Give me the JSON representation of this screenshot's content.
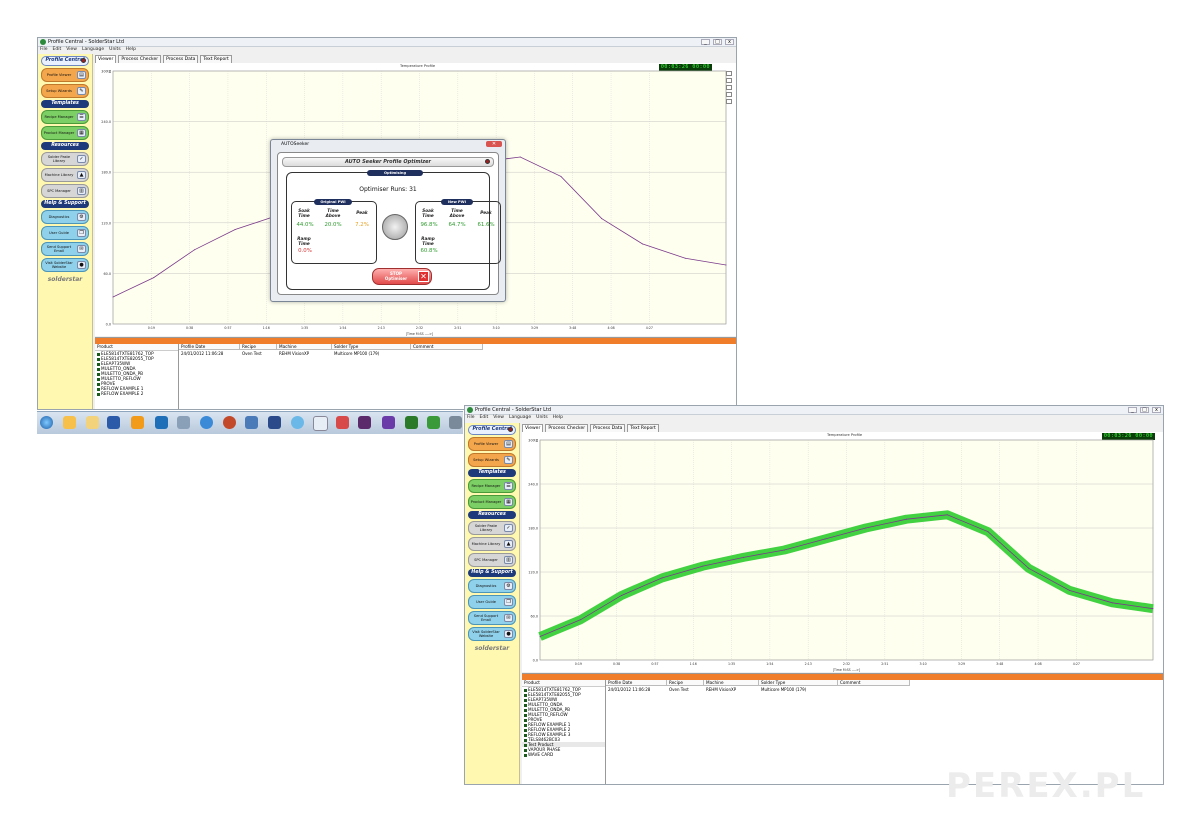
{
  "app": {
    "title": "Profile Central - SolderStar Ltd",
    "menu": [
      "File",
      "Edit",
      "View",
      "Language",
      "Units",
      "Help"
    ],
    "window_controls": [
      "_",
      "□",
      "x"
    ]
  },
  "sidebar": {
    "header": "Profile Central",
    "buttons_top": [
      {
        "label": "Profile Viewer",
        "icon": "chart-icon"
      },
      {
        "label": "Setup Wizards",
        "icon": "wand-icon"
      }
    ],
    "templates_header": "Templates",
    "templates_buttons": [
      {
        "label": "Recipe Manager",
        "icon": "recipe-icon"
      },
      {
        "label": "Product Manager",
        "icon": "board-icon"
      }
    ],
    "resources_header": "Resources",
    "resources_buttons": [
      {
        "label": "Solder Paste Library",
        "icon": "paste-icon"
      },
      {
        "label": "Machine Library",
        "icon": "machine-icon"
      },
      {
        "label": "SPC Manager",
        "icon": "spc-icon"
      }
    ],
    "help_header": "Help & Support",
    "help_buttons": [
      {
        "label": "Diagnostics",
        "icon": "diagnostics-icon"
      },
      {
        "label": "User Guide",
        "icon": "book-icon"
      },
      {
        "label": "Send Support Email",
        "icon": "email-icon"
      },
      {
        "label": "Visit SolderStar Website",
        "icon": "globe-icon"
      }
    ],
    "logo": "solderstar"
  },
  "tabs": [
    "Viewer",
    "Process Checker",
    "Process Data",
    "Text Report"
  ],
  "chart": {
    "title": "Temperature Profile",
    "unit": "°C",
    "x_label": "[Time M:SS ---->]",
    "clock_top": "00:03:26  00:00",
    "clock_bottom": "00:03:26  00:00"
  },
  "chart_data": [
    {
      "type": "line",
      "title": "Temperature Profile",
      "ylabel": "°C",
      "xlabel": "[Time M:SS ---->]",
      "ylim": [
        0,
        300
      ],
      "yticks": [
        "0.0",
        "60.0",
        "120.0",
        "180.0",
        "240.0",
        "300.0"
      ],
      "xticks": [
        "0:19",
        "0:38",
        "0:57",
        "1:16",
        "1:35",
        "1:54",
        "2:13",
        "2:32",
        "2:51",
        "3:10",
        "3:29",
        "3:48",
        "4:08",
        "4:27"
      ],
      "x": [
        0,
        19,
        38,
        57,
        76,
        95,
        114,
        133,
        152,
        171,
        190,
        209,
        228,
        247,
        267,
        286
      ],
      "series": [
        {
          "values": [
            32,
            55,
            88,
            112,
            128,
            140,
            150,
            165,
            180,
            192,
            198,
            175,
            125,
            95,
            78,
            70
          ]
        }
      ]
    },
    {
      "type": "line",
      "title": "Temperature Profile",
      "ylabel": "°C",
      "xlabel": "[Time M:SS ---->]",
      "ylim": [
        0,
        300
      ],
      "yticks": [
        "0.0",
        "60.0",
        "120.0",
        "180.0",
        "240.0",
        "300.0"
      ],
      "xticks": [
        "0:19",
        "0:38",
        "0:57",
        "1:16",
        "1:35",
        "1:54",
        "2:13",
        "2:32",
        "2:51",
        "3:10",
        "3:29",
        "3:48",
        "4:08",
        "4:27"
      ],
      "x": [
        0,
        19,
        38,
        57,
        76,
        95,
        114,
        133,
        152,
        171,
        190,
        209,
        228,
        247,
        267,
        286
      ],
      "series": [
        {
          "values": [
            32,
            55,
            88,
            112,
            128,
            140,
            150,
            165,
            180,
            192,
            198,
            175,
            125,
            95,
            78,
            70
          ]
        }
      ]
    }
  ],
  "colors": {
    "plot_bg": "#fffff0",
    "profile_line": "#7a3a8a",
    "process_window": "#2ecc2e",
    "orange_header": "#f07d2a",
    "sidebar_bg": "#fff8b0"
  },
  "products": {
    "header": "Product",
    "items_top": [
      "ELE5814TXTE81762_TOP",
      "ELE5814TXTE82055_TOP",
      "ELEAP735WW",
      "MULETTO_ONDA",
      "MULETTO_ONDA_PB",
      "MULETTO_REFLOW",
      "PROVE",
      "REFLOW EXAMPLE 1",
      "REFLOW EXAMPLE 2"
    ],
    "items_bottom": [
      "ELE5814TXTE81762_TOP",
      "ELE5814TXTE82055_TOP",
      "ELEAP735WW",
      "MULETTO_ONDA",
      "MULETTO_ONDA_PB",
      "MULETTO_REFLOW",
      "PROVE",
      "REFLOW EXAMPLE 1",
      "REFLOW EXAMPLE 2",
      "REFLOW EXAMPLE 3",
      "TELS8462BC03",
      "Test Product",
      "VAPOUR PHASE",
      "WAVE CARD"
    ]
  },
  "profiles": {
    "headers": [
      "Profile Date",
      "Recipe",
      "Machine",
      "Solder Type",
      "Comment"
    ],
    "row": [
      "24/01/2012 11:06:28",
      "Oven Test",
      "REHM VisionXP",
      "Multicore MP100 (179)",
      ""
    ]
  },
  "dialog": {
    "title": "AUTOSeeker",
    "header": "AUTO Seeker Profile Optimizer",
    "status": "Optimising",
    "runs": "Optimiser Runs: 31",
    "original_label": "Original PWI",
    "new_label": "New PWI",
    "metric_labels": [
      "Soak Time",
      "Time Above",
      "Peak",
      "Ramp Time"
    ],
    "original_values": [
      "44.0%",
      "20.0%",
      "7.2%",
      "0.0%"
    ],
    "new_values": [
      "96.8%",
      "64.7%",
      "61.6%",
      "60.8%"
    ],
    "stop_label": "STOP Optimiser"
  },
  "watermark": "PEREX.PL"
}
